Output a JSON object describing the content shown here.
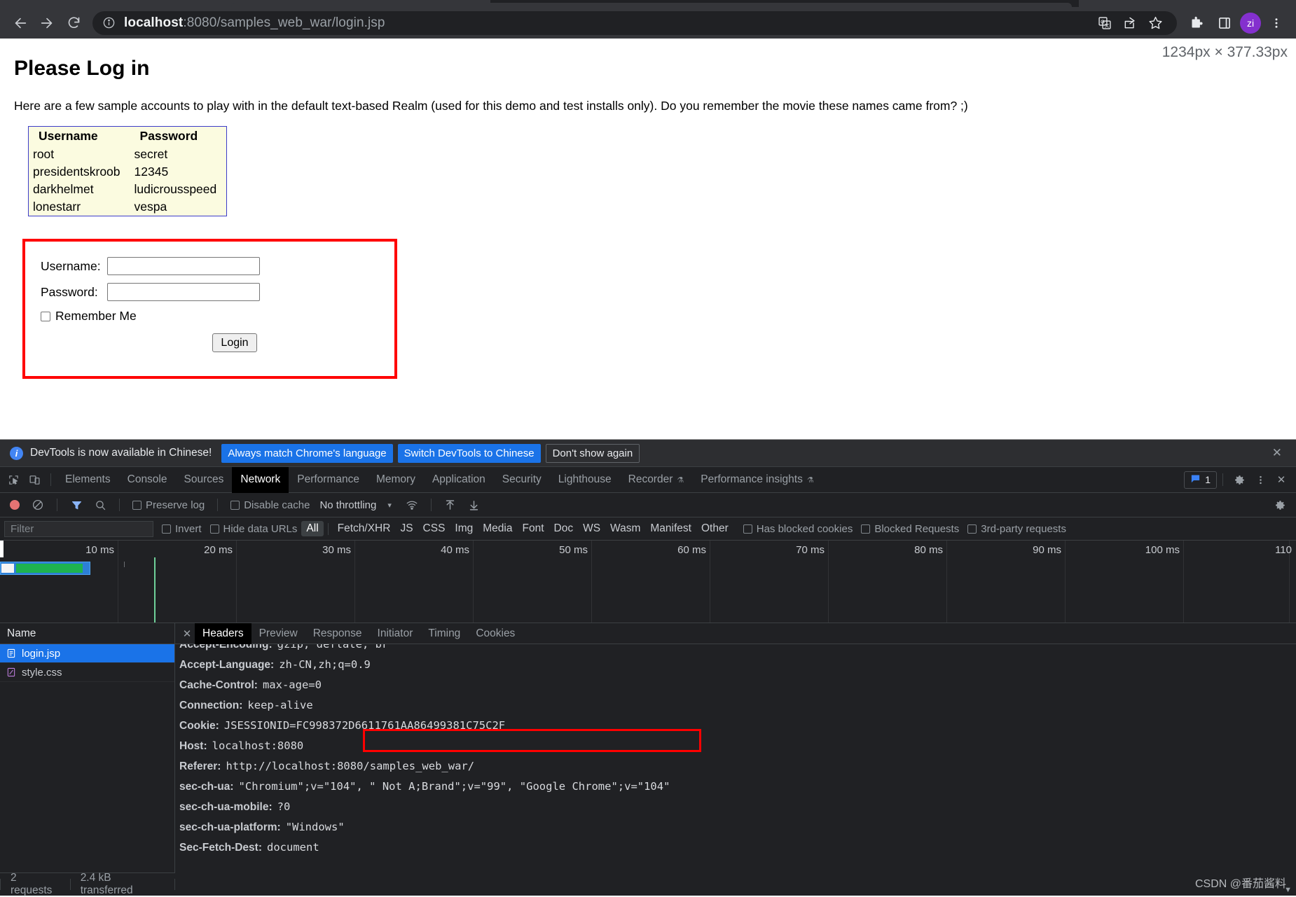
{
  "browser": {
    "url_host": "localhost",
    "url_rest": ":8080/samples_web_war/login.jsp",
    "back_icon": "back-arrow-icon",
    "forward_icon": "forward-arrow-icon",
    "reload_icon": "reload-icon",
    "site_info_icon": "site-info-icon",
    "translate_icon": "translate-icon",
    "share_icon": "share-icon",
    "bookmark_icon": "bookmark-star-icon",
    "extensions_icon": "extensions-puzzle-icon",
    "sidepanel_icon": "side-panel-icon",
    "avatar_label": "zi",
    "menu_icon": "three-dot-menu-icon"
  },
  "page": {
    "viewport_size": "1234px × 377.33px",
    "title": "Please Log in",
    "intro": "Here are a few sample accounts to play with in the default text-based Realm (used for this demo and test installs only). Do you remember the movie these names came from? ;)",
    "accounts_table": {
      "headers": [
        "Username",
        "Password"
      ],
      "rows": [
        [
          "root",
          "secret"
        ],
        [
          "presidentskroob",
          "12345"
        ],
        [
          "darkhelmet",
          "ludicrousspeed"
        ],
        [
          "lonestarr",
          "vespa"
        ]
      ]
    },
    "form": {
      "username_label": "Username:",
      "username_value": "",
      "password_label": "Password:",
      "password_value": "",
      "remember_label": "Remember Me",
      "login_button": "Login"
    }
  },
  "devtools": {
    "banner": {
      "message": "DevTools is now available in Chinese!",
      "btn_always": "Always match Chrome's language",
      "btn_switch": "Switch DevTools to Chinese",
      "btn_dismiss": "Don't show again",
      "close_icon": "close-icon",
      "info_icon": "info-icon"
    },
    "tabs": [
      {
        "label": "Elements",
        "active": false
      },
      {
        "label": "Console",
        "active": false
      },
      {
        "label": "Sources",
        "active": false
      },
      {
        "label": "Network",
        "active": true
      },
      {
        "label": "Performance",
        "active": false
      },
      {
        "label": "Memory",
        "active": false
      },
      {
        "label": "Application",
        "active": false
      },
      {
        "label": "Security",
        "active": false
      },
      {
        "label": "Lighthouse",
        "active": false
      },
      {
        "label": "Recorder",
        "active": false,
        "experimental": true
      },
      {
        "label": "Performance insights",
        "active": false,
        "experimental": true
      }
    ],
    "tabs_left_icons": [
      "inspect-element-icon",
      "device-toolbar-icon"
    ],
    "tabs_right": {
      "message_count": "1",
      "message_icon": "console-message-icon",
      "settings_icon": "gear-icon",
      "more_icon": "three-dot-menu-icon",
      "close_icon": "close-icon"
    },
    "toolbar": {
      "record_icon": "record-stop-icon",
      "clear_icon": "clear-icon",
      "filter_icon": "funnel-filter-icon",
      "search_icon": "search-icon",
      "preserve_log": "Preserve log",
      "disable_cache": "Disable cache",
      "throttling": "No throttling",
      "throttle_caret": "▾",
      "wifi_icon": "network-conditions-icon",
      "import_icon": "import-har-icon",
      "export_icon": "export-har-icon",
      "settings_icon": "gear-icon"
    },
    "filterbar": {
      "placeholder": "Filter",
      "invert": "Invert",
      "hide_data_urls": "Hide data URLs",
      "types": [
        "All",
        "Fetch/XHR",
        "JS",
        "CSS",
        "Img",
        "Media",
        "Font",
        "Doc",
        "WS",
        "Wasm",
        "Manifest",
        "Other"
      ],
      "active_type": "All",
      "has_blocked_cookies": "Has blocked cookies",
      "blocked_requests": "Blocked Requests",
      "third_party": "3rd-party requests"
    },
    "overview": {
      "ticks": [
        "10 ms",
        "20 ms",
        "30 ms",
        "40 ms",
        "50 ms",
        "60 ms",
        "70 ms",
        "80 ms",
        "90 ms",
        "100 ms",
        "110"
      ]
    },
    "requests": {
      "column_header": "Name",
      "rows": [
        {
          "name": "login.jsp",
          "icon": "document-file-icon",
          "selected": true
        },
        {
          "name": "style.css",
          "icon": "stylesheet-file-icon",
          "selected": false
        }
      ]
    },
    "detail_tabs": [
      {
        "label": "Headers",
        "active": true
      },
      {
        "label": "Preview",
        "active": false
      },
      {
        "label": "Response",
        "active": false
      },
      {
        "label": "Initiator",
        "active": false
      },
      {
        "label": "Timing",
        "active": false
      },
      {
        "label": "Cookies",
        "active": false
      }
    ],
    "detail_close_icon": "close-icon",
    "headers": [
      {
        "name": "Accept-Encoding:",
        "value": "gzip, deflate, br",
        "clipped": true
      },
      {
        "name": "Accept-Language:",
        "value": "zh-CN,zh;q=0.9"
      },
      {
        "name": "Cache-Control:",
        "value": "max-age=0"
      },
      {
        "name": "Connection:",
        "value": "keep-alive"
      },
      {
        "name": "Cookie:",
        "value": "JSESSIONID=FC998372D6611761AA86499381C75C2F",
        "highlighted": true
      },
      {
        "name": "Host:",
        "value": "localhost:8080"
      },
      {
        "name": "Referer:",
        "value": "http://localhost:8080/samples_web_war/"
      },
      {
        "name": "sec-ch-ua:",
        "value": "\"Chromium\";v=\"104\", \" Not A;Brand\";v=\"99\", \"Google Chrome\";v=\"104\""
      },
      {
        "name": "sec-ch-ua-mobile:",
        "value": "?0"
      },
      {
        "name": "sec-ch-ua-platform:",
        "value": "\"Windows\""
      },
      {
        "name": "Sec-Fetch-Dest:",
        "value": "document"
      }
    ],
    "status": {
      "requests": "2 requests",
      "transferred": "2.4 kB transferred"
    }
  },
  "watermark": "CSDN @番茄酱料",
  "colors": {
    "accent_blue": "#1a73e8",
    "highlight_red": "#ff0000",
    "table_bg": "#fbfbe0",
    "table_border": "#3c3cc8",
    "avatar_purple": "#8430ce",
    "devtools_bg": "#202124"
  }
}
